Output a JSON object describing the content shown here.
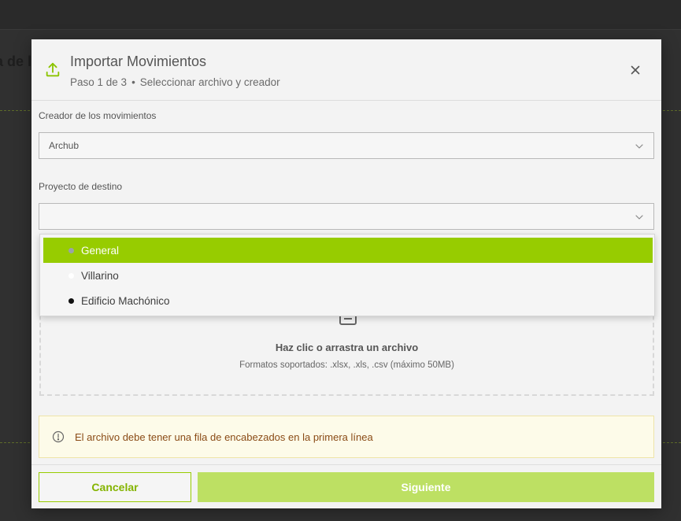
{
  "background": {
    "page_title_fragment": "a de l"
  },
  "modal": {
    "title": "Importar Movimientos",
    "step": "Paso 1 de 3",
    "separator": "•",
    "step_description": "Seleccionar archivo y creador",
    "icons": {
      "header": "upload-icon",
      "close": "close-icon"
    }
  },
  "creator_field": {
    "label": "Creador de los movimientos",
    "value": "Archub"
  },
  "project_field": {
    "label": "Proyecto de destino",
    "value": "",
    "options": [
      {
        "label": "General",
        "dot_color": "#9aa3a8",
        "selected": true
      },
      {
        "label": "Villarino",
        "dot_color": "#ffffff",
        "selected": false
      },
      {
        "label": "Edificio Machónico",
        "dot_color": "#111111",
        "selected": false
      }
    ]
  },
  "dropzone": {
    "title": "Haz clic o arrastra un archivo",
    "formats": "Formatos soportados: .xlsx, .xls, .csv (máximo 50MB)"
  },
  "notice": {
    "text": "El archivo debe tener una fila de encabezados en la primera línea"
  },
  "footer": {
    "cancel_label": "Cancelar",
    "next_label": "Siguiente"
  },
  "colors": {
    "accent": "#97cc00",
    "accent_light": "#bde063",
    "notice_text": "#8a4b16",
    "notice_bg": "#fdfbe9"
  }
}
